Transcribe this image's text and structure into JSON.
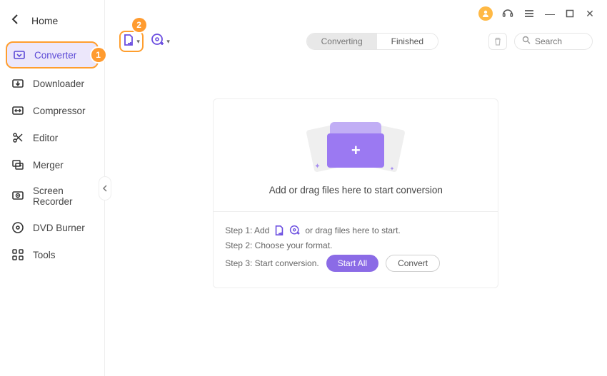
{
  "colors": {
    "accent": "#8b6be6",
    "callout": "#ff9b2f"
  },
  "titlebar": {
    "avatar_icon": "user-icon",
    "support_icon": "headset-icon",
    "menu_icon": "hamburger-icon",
    "min": "—",
    "max": "▢",
    "close": "✕"
  },
  "sidebar": {
    "back_label": "Home",
    "items": [
      {
        "label": "Converter",
        "icon": "converter-icon"
      },
      {
        "label": "Downloader",
        "icon": "download-icon"
      },
      {
        "label": "Compressor",
        "icon": "compress-icon"
      },
      {
        "label": "Editor",
        "icon": "scissors-icon"
      },
      {
        "label": "Merger",
        "icon": "merge-icon"
      },
      {
        "label": "Screen Recorder",
        "icon": "recorder-icon"
      },
      {
        "label": "DVD Burner",
        "icon": "disc-icon"
      },
      {
        "label": "Tools",
        "icon": "grid-icon"
      }
    ]
  },
  "callouts": {
    "one": "1",
    "two": "2"
  },
  "topbar": {
    "add_file_icon": "add-file-icon",
    "add_disc_icon": "add-disc-icon",
    "tabs": {
      "converting": "Converting",
      "finished": "Finished"
    },
    "trash_icon": "trash-icon",
    "search": {
      "placeholder": "Search",
      "value": ""
    }
  },
  "drop": {
    "text": "Add or drag files here to start conversion"
  },
  "steps": {
    "s1_pre": "Step 1: Add",
    "s1_post": "or drag files here to start.",
    "s2": "Step 2: Choose your format.",
    "s3_pre": "Step 3: Start conversion.",
    "start_all": "Start All",
    "convert": "Convert"
  }
}
